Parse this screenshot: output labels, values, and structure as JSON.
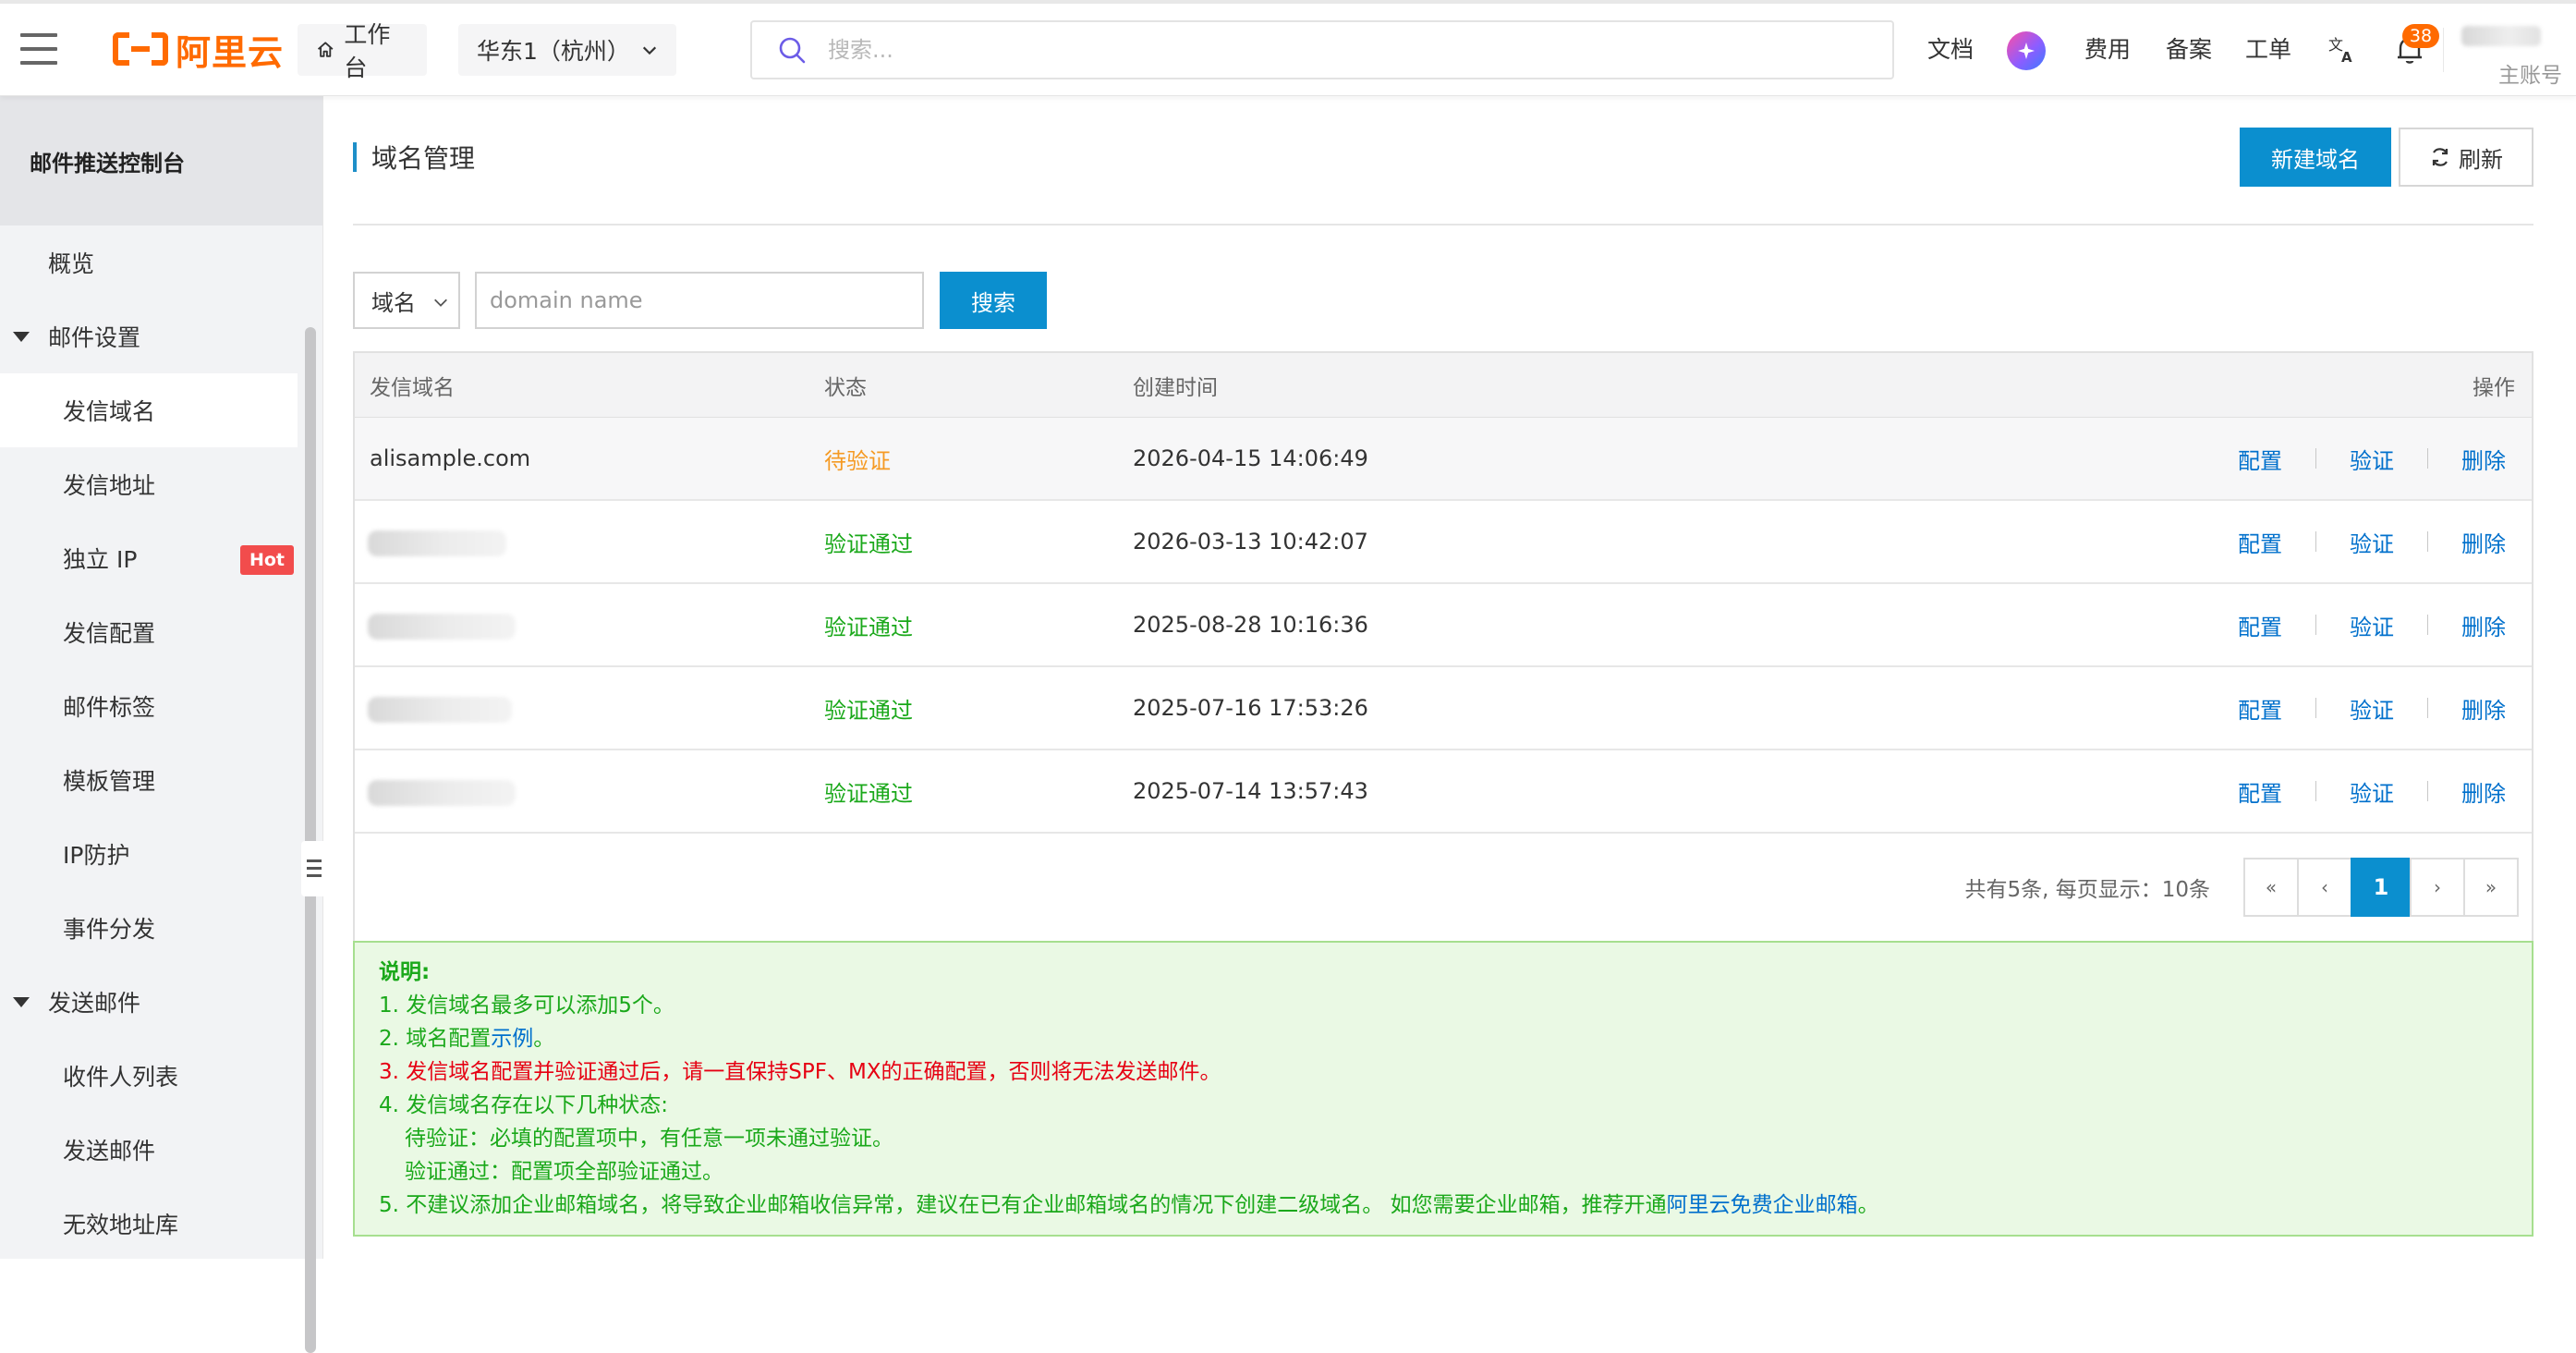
{
  "topbar": {
    "logo_text": "阿里云",
    "workbench": "工作台",
    "region": "华东1（杭州）",
    "search_placeholder": "搜索...",
    "nav": [
      "文档",
      "费用",
      "备案",
      "工单"
    ],
    "notification_count": "38",
    "account_label": "主账号"
  },
  "sidebar": {
    "title": "邮件推送控制台",
    "items": [
      {
        "label": "概览"
      },
      {
        "label": "邮件设置"
      },
      {
        "label": "发信域名"
      },
      {
        "label": "发信地址"
      },
      {
        "label": "独立 IP",
        "badge": "Hot"
      },
      {
        "label": "发信配置"
      },
      {
        "label": "邮件标签"
      },
      {
        "label": "模板管理"
      },
      {
        "label": "IP防护"
      },
      {
        "label": "事件分发"
      },
      {
        "label": "发送邮件"
      },
      {
        "label": "收件人列表"
      },
      {
        "label": "发送邮件"
      },
      {
        "label": "无效地址库"
      }
    ]
  },
  "main": {
    "title": "域名管理",
    "new_button": "新建域名",
    "refresh_button": "刷新",
    "filter": {
      "select_value": "域名",
      "input_placeholder": "domain name",
      "search_button": "搜索"
    },
    "table": {
      "headers": {
        "domain": "发信域名",
        "status": "状态",
        "created": "创建时间",
        "ops": "操作"
      },
      "rows": [
        {
          "domain": "alisample.com",
          "status": "待验证",
          "status_type": "pending",
          "created": "2026-04-15 14:06:49"
        },
        {
          "domain": "",
          "status": "验证通过",
          "status_type": "ok",
          "created": "2026-03-13 10:42:07"
        },
        {
          "domain": "",
          "status": "验证通过",
          "status_type": "ok",
          "created": "2025-08-28 10:16:36"
        },
        {
          "domain": "",
          "status": "验证通过",
          "status_type": "ok",
          "created": "2025-07-16 17:53:26"
        },
        {
          "domain": "",
          "status": "验证通过",
          "status_type": "ok",
          "created": "2025-07-14 13:57:43"
        }
      ],
      "ops": {
        "config": "配置",
        "verify": "验证",
        "delete": "删除"
      }
    },
    "pagination": {
      "info": "共有5条, 每页显示：10条",
      "first": "«",
      "prev": "‹",
      "current": "1",
      "next": "›",
      "last": "»"
    },
    "notice": {
      "title": "说明:",
      "line1": "1. 发信域名最多可以添加5个。",
      "line2_prefix": "2. 域名配置",
      "line2_link": "示例",
      "line2_suffix": "。",
      "line3": "3. 发信域名配置并验证通过后，请一直保持SPF、MX的正确配置，否则将无法发送邮件。",
      "line4": "4. 发信域名存在以下几种状态:",
      "line4a": "待验证：必填的配置项中，有任意一项未通过验证。",
      "line4b": "验证通过：配置项全部验证通过。",
      "line5_prefix": "5. 不建议添加企业邮箱域名，将导致企业邮箱收信异常，建议在已有企业邮箱域名的情况下创建二级域名。 如您需要企业邮箱，推荐开通",
      "line5_link": "阿里云免费企业邮箱",
      "line5_suffix": "。"
    }
  },
  "colors": {
    "brand_orange": "#ff6a00",
    "primary_blue": "#0b8fcf",
    "link_blue": "#0070cc",
    "status_pending": "#f59a23",
    "status_ok": "#1aa81a",
    "warning_red": "#e60012",
    "hot_badge": "#f24c4c"
  }
}
